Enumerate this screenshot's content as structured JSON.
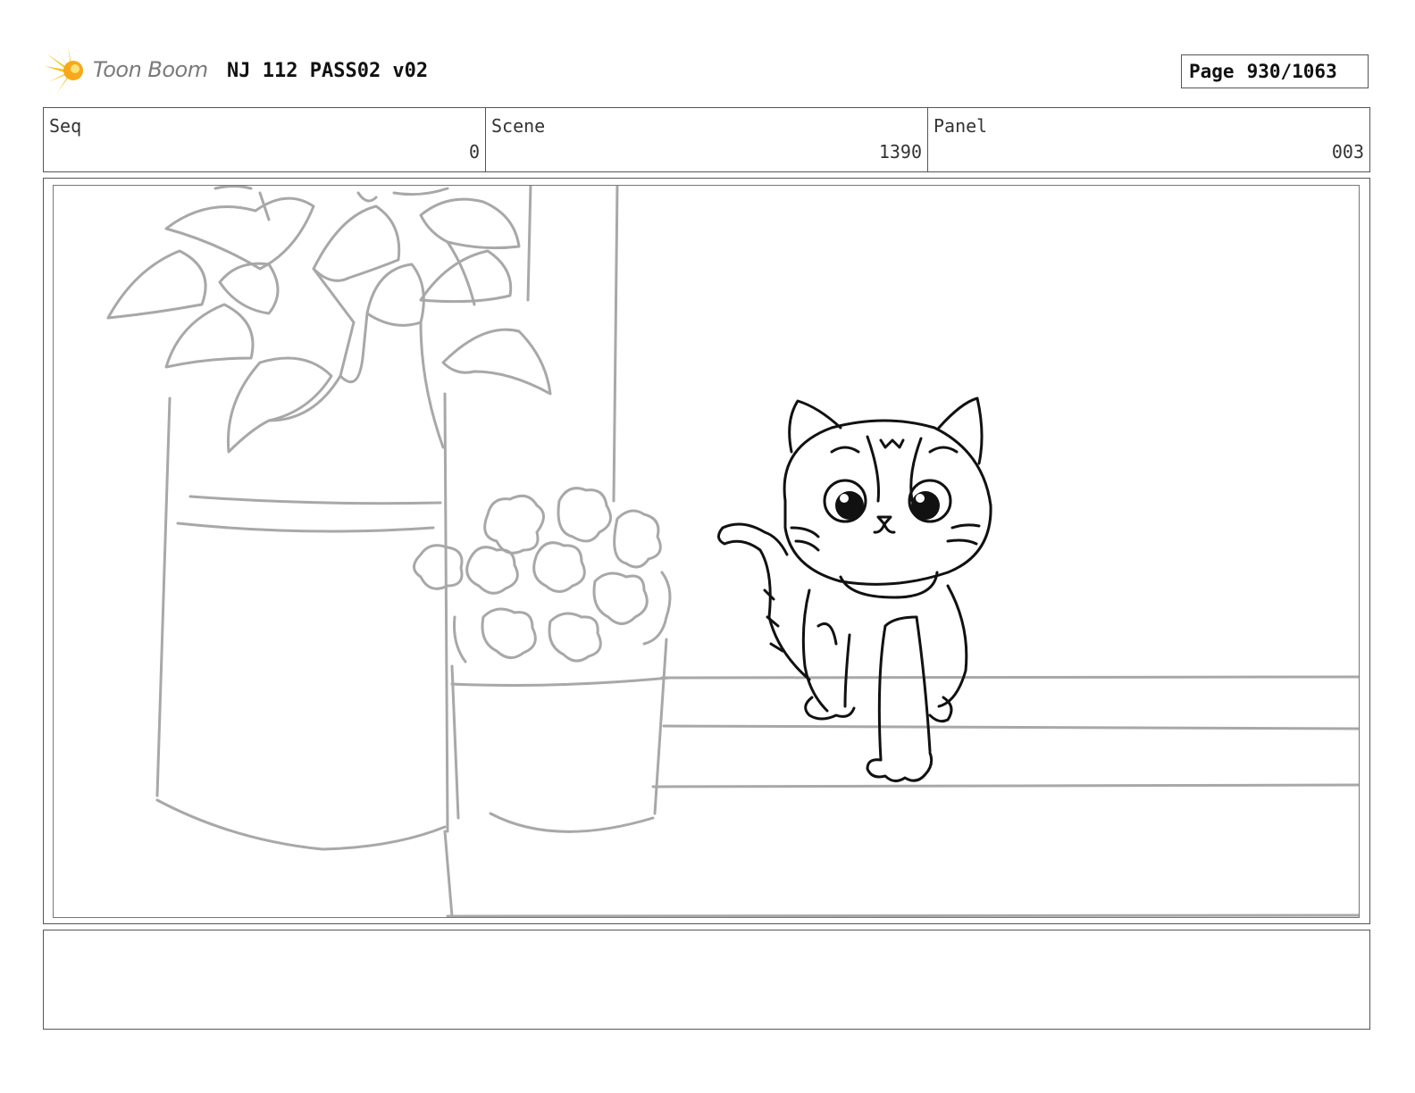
{
  "header": {
    "logo_text": "Toon Boom",
    "project_title": "NJ 112 PASS02 v02",
    "page_label": "Page",
    "page_value": "930/1063"
  },
  "info": {
    "seq_label": "Seq",
    "seq_value": "0",
    "scene_label": "Scene",
    "scene_value": "1390",
    "panel_label": "Panel",
    "panel_value": "003"
  },
  "notes": {
    "text": ""
  },
  "colors": {
    "border": "#555555",
    "sketch_gray": "#a8a8a8",
    "sketch_black": "#111111",
    "logo_yellow": "#f5c518"
  }
}
